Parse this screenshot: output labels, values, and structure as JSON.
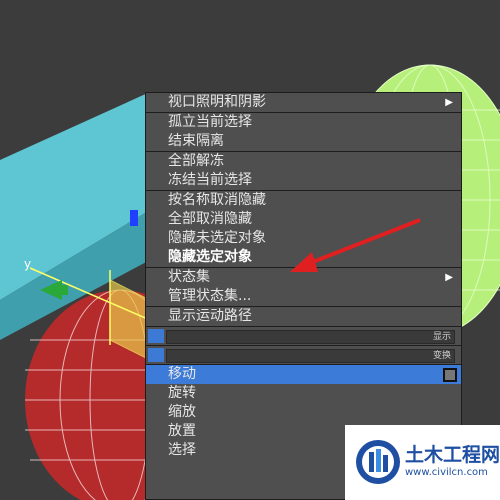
{
  "menu": {
    "sections": [
      [
        {
          "label": "视口照明和阴影",
          "submenu": true
        }
      ],
      [
        {
          "label": "孤立当前选择"
        },
        {
          "label": "结束隔离"
        }
      ],
      [
        {
          "label": "全部解冻"
        },
        {
          "label": "冻结当前选择"
        }
      ],
      [
        {
          "label": "按名称取消隐藏"
        },
        {
          "label": "全部取消隐藏"
        },
        {
          "label": "隐藏未选定对象"
        },
        {
          "label": "隐藏选定对象",
          "highlight": true
        }
      ],
      [
        {
          "label": "状态集",
          "submenu": true
        },
        {
          "label": "管理状态集..."
        }
      ],
      [
        {
          "label": "显示运动路径"
        }
      ]
    ],
    "bars": [
      {
        "label": "显示"
      },
      {
        "label": "变换"
      }
    ],
    "transform_items": [
      {
        "label": "移动",
        "active": true
      },
      {
        "label": "旋转"
      },
      {
        "label": "缩放"
      },
      {
        "label": "放置"
      },
      {
        "label": "选择"
      }
    ]
  },
  "viewport": {
    "axis_label": "y"
  },
  "watermark": {
    "text": "土木工程网",
    "url": "www.civilcn.com"
  },
  "colors": {
    "annotation_arrow": "#e02020",
    "active_item": "#3d7bd9",
    "cyan_box": "#5ec5d2",
    "green_sphere": "#b8f27a",
    "red_sphere": "#b82a2a"
  }
}
